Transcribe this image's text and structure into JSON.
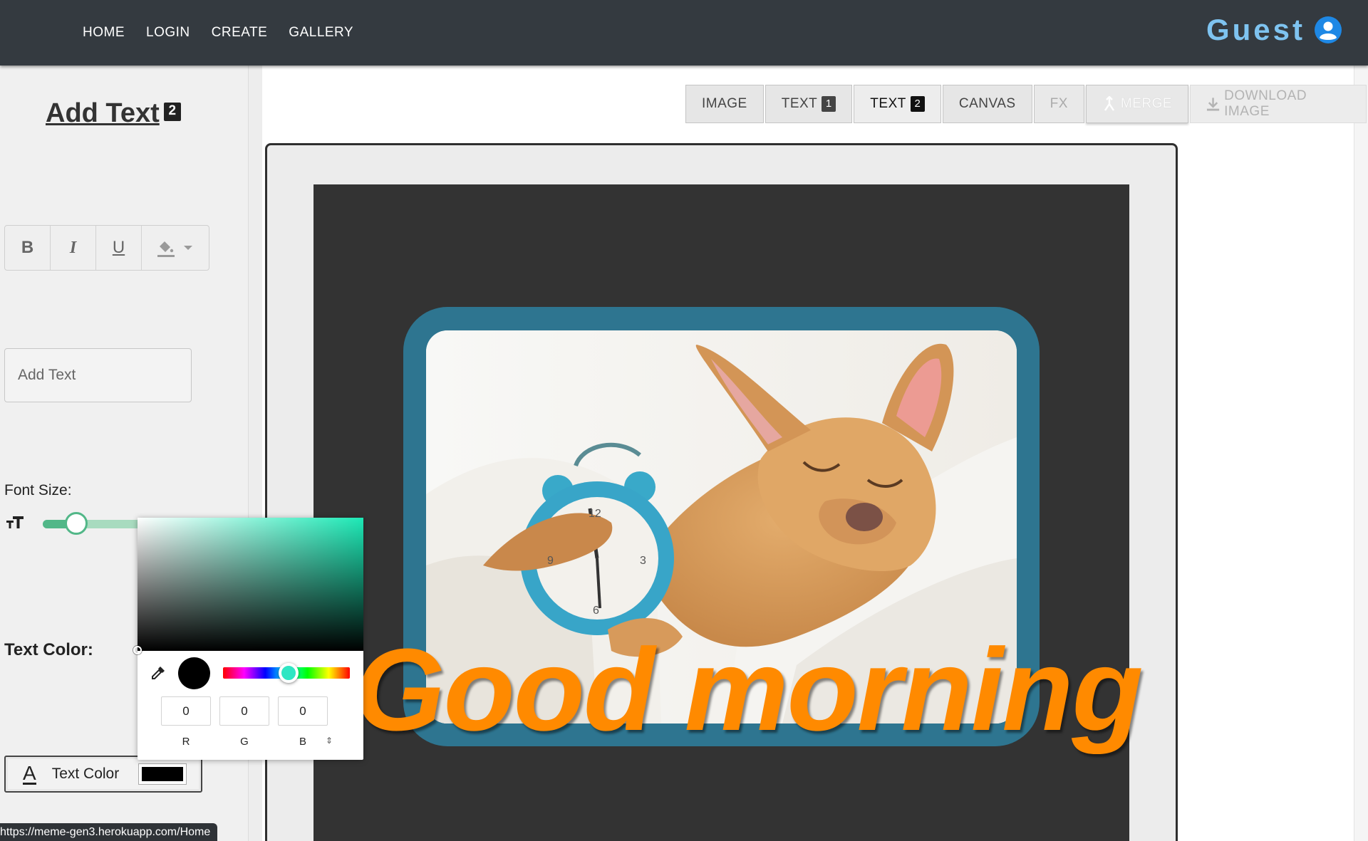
{
  "nav": {
    "links": [
      "HOME",
      "LOGIN",
      "CREATE",
      "GALLERY"
    ],
    "user_label": "Guest",
    "user_icon": "user-circle-icon"
  },
  "panel": {
    "title": "Add Text",
    "badge": "2",
    "format_buttons": {
      "bold": "B",
      "italic": "I",
      "underline": "U",
      "fill_icon": "paint-bucket-icon"
    },
    "text_input": {
      "value": "",
      "placeholder": "Add Text"
    },
    "font_size_label": "Font Size:",
    "font_size_icon": "text-size-icon",
    "font_size_slider": {
      "value_fraction": 0.28
    },
    "text_color_label": "Text Color:",
    "text_color_button": {
      "icon_letter": "A",
      "label": "Text Color",
      "swatch_color": "#000000"
    }
  },
  "color_picker": {
    "hue_color": "#1de9b6",
    "preview_color": "#000000",
    "hue_position_fraction": 0.45,
    "eyedropper_icon": "eyedropper-icon",
    "r": "0",
    "g": "0",
    "b": "0",
    "labels": [
      "R",
      "G",
      "B"
    ],
    "mode_toggle": "⇕"
  },
  "tabs": [
    {
      "label": "IMAGE",
      "badge": ""
    },
    {
      "label": "TEXT",
      "badge": "1"
    },
    {
      "label": "TEXT",
      "badge": "2",
      "active": true
    },
    {
      "label": "CANVAS",
      "badge": ""
    },
    {
      "label": "FX",
      "badge": "",
      "disabled": true
    },
    {
      "label": "MERGE",
      "icon": "merge-icon"
    },
    {
      "label": "DOWNLOAD IMAGE",
      "icon": "download-icon",
      "disabled": true
    }
  ],
  "canvas": {
    "background_color": "#333333",
    "photo_border_color": "#2e7590",
    "meme_text": "Good morning",
    "meme_text_color": "#ff8a00",
    "photo_subject": "sleeping-dog-with-alarm-clock-image"
  },
  "status_bar": {
    "url": "https://meme-gen3.herokuapp.com/Home"
  }
}
